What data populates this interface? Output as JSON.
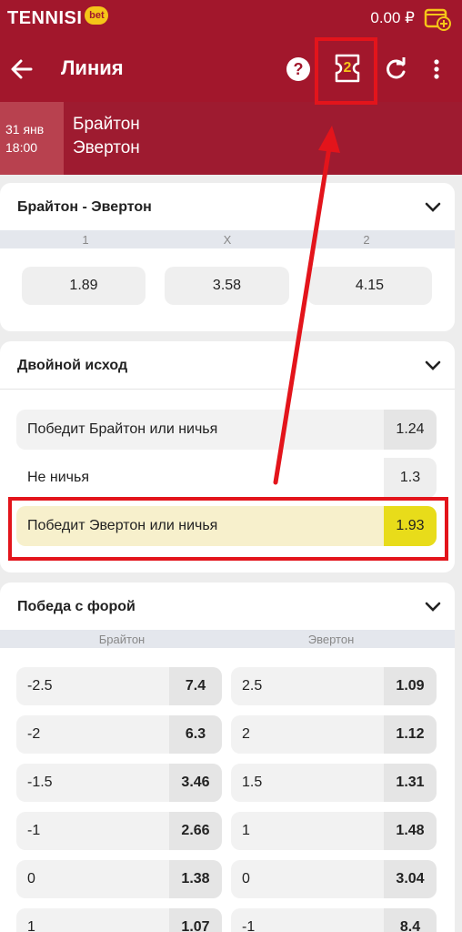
{
  "app": {
    "brand": "TENNISI",
    "brand_badge": "bet",
    "balance": "0.00 ₽",
    "title": "Линия",
    "coupon_count": "2",
    "help_glyph": "?"
  },
  "match": {
    "date": "31 янв",
    "time": "18:00",
    "team1": "Брайтон",
    "team2": "Эвертон"
  },
  "main_market": {
    "title": "Брайтон - Эвертон",
    "headers": [
      "1",
      "X",
      "2"
    ],
    "odds": [
      "1.89",
      "3.58",
      "4.15"
    ]
  },
  "double_chance": {
    "title": "Двойной исход",
    "rows": [
      {
        "label": "Победит Брайтон или ничья",
        "odd": "1.24"
      },
      {
        "label": "Не ничья",
        "odd": "1.3"
      },
      {
        "label": "Победит Эвертон или ничья",
        "odd": "1.93"
      }
    ]
  },
  "handicap": {
    "title": "Победа с форой",
    "headers": [
      "Брайтон",
      "Эвертон"
    ],
    "rows": [
      {
        "l_label": "-2.5",
        "l_odd": "7.4",
        "r_label": "2.5",
        "r_odd": "1.09"
      },
      {
        "l_label": "-2",
        "l_odd": "6.3",
        "r_label": "2",
        "r_odd": "1.12"
      },
      {
        "l_label": "-1.5",
        "l_odd": "3.46",
        "r_label": "1.5",
        "r_odd": "1.31"
      },
      {
        "l_label": "-1",
        "l_odd": "2.66",
        "r_label": "1",
        "r_odd": "1.48"
      },
      {
        "l_label": "0",
        "l_odd": "1.38",
        "r_label": "0",
        "r_odd": "3.04"
      },
      {
        "l_label": "1",
        "l_odd": "1.07",
        "r_label": "-1",
        "r_odd": "8.4"
      }
    ]
  },
  "colors": {
    "header": "#a2172c",
    "accent_yellow": "#f5c518",
    "selected_odd": "#e8dc1a",
    "annotation": "#e3141b"
  },
  "icons": [
    "wallet-add-icon",
    "back-arrow-icon",
    "help-icon",
    "coupon-icon",
    "refresh-icon",
    "more-vertical-icon",
    "chevron-down-icon"
  ]
}
